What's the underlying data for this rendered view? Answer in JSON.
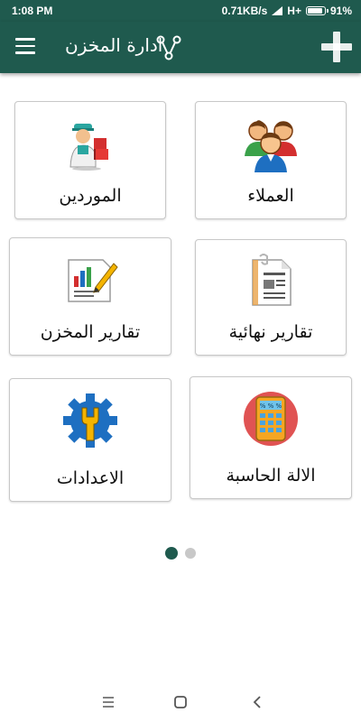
{
  "status_bar": {
    "time": "1:08 PM",
    "network_speed": "0.71KB/s",
    "signal": "H+",
    "battery": "91%",
    "battery_level": 0.91
  },
  "app_bar": {
    "title": "ادارة المخزن",
    "menu_icon": "hamburger-icon",
    "add_icon": "plus-icon",
    "logo_icon": "share-nodes-icon"
  },
  "grid": {
    "customers": {
      "label": "العملاء",
      "icon": "customers-group-icon"
    },
    "suppliers": {
      "label": "الموردين",
      "icon": "supplier-delivery-icon"
    },
    "final_reports": {
      "label": "تقارير نهائية",
      "icon": "report-document-icon"
    },
    "warehouse_reports": {
      "label": "تقارير المخزن",
      "icon": "chart-report-icon"
    },
    "calculator": {
      "label": "الالة الحاسبة",
      "icon": "calculator-icon"
    },
    "settings": {
      "label": "الاعدادات",
      "icon": "gear-wrench-icon"
    }
  },
  "pagination": {
    "pages": 2,
    "current": 1
  },
  "colors": {
    "primary": "#1f5a4e",
    "dot_inactive": "#c8c8c8"
  }
}
